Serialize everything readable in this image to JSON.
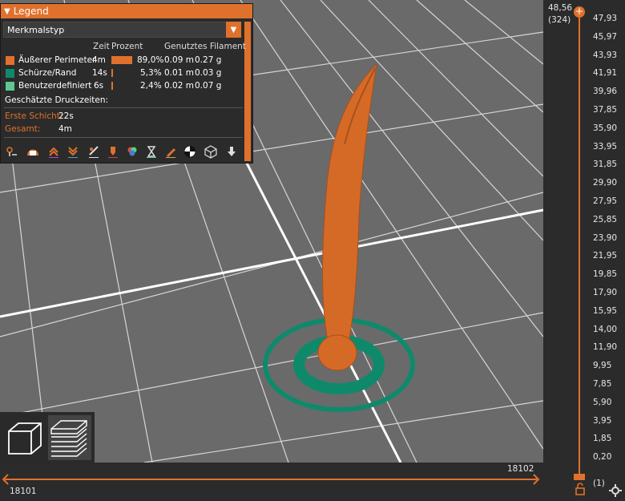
{
  "legend": {
    "title": "Legend",
    "view_type": "Merkmalstyp",
    "columns": {
      "time": "Zeit",
      "percent": "Prozent",
      "filament": "Genutztes Filament"
    },
    "rows": [
      {
        "label": "Äußerer Perimeter",
        "time": "4m",
        "percent": "89,0%",
        "length": "0.09 m",
        "weight": "0.27 g",
        "color": "#e0712c",
        "fraction": 0.89
      },
      {
        "label": "Schürze/Rand",
        "time": "14s",
        "percent": "5,3%",
        "length": "0.01 m",
        "weight": "0.03 g",
        "color": "#0e8a6b",
        "fraction": 0.053
      },
      {
        "label": "Benutzerdefiniert",
        "time": "6s",
        "percent": "2,4%",
        "length": "0.02 m",
        "weight": "0.07 g",
        "color": "#5ec98e",
        "fraction": 0.024
      }
    ],
    "estimated_title": "Geschätzte Druckzeiten:",
    "first_layer_label": "Erste Schicht:",
    "first_layer_value": "22s",
    "total_label": "Gesamt:",
    "total_value": "4m"
  },
  "vertical_slider": {
    "top_value": "48,56",
    "top_layer": "(324)",
    "ticks": [
      "47,93",
      "45,97",
      "43,93",
      "41,91",
      "39,96",
      "37,85",
      "35,90",
      "33,95",
      "31,85",
      "29,90",
      "27,95",
      "25,85",
      "23,90",
      "21,95",
      "19,85",
      "17,90",
      "15,95",
      "14,00",
      "11,90",
      "9,95",
      "7,85",
      "5,90",
      "3,95",
      "1,85",
      "0,20"
    ],
    "bottom_layer": "(1)"
  },
  "horizontal_slider": {
    "left_value": "18101",
    "right_value": "18102"
  },
  "colors": {
    "accent": "#e0712c",
    "skirt": "#0e8a6b",
    "custom": "#5ec98e",
    "bed": "#6e6e6e"
  }
}
